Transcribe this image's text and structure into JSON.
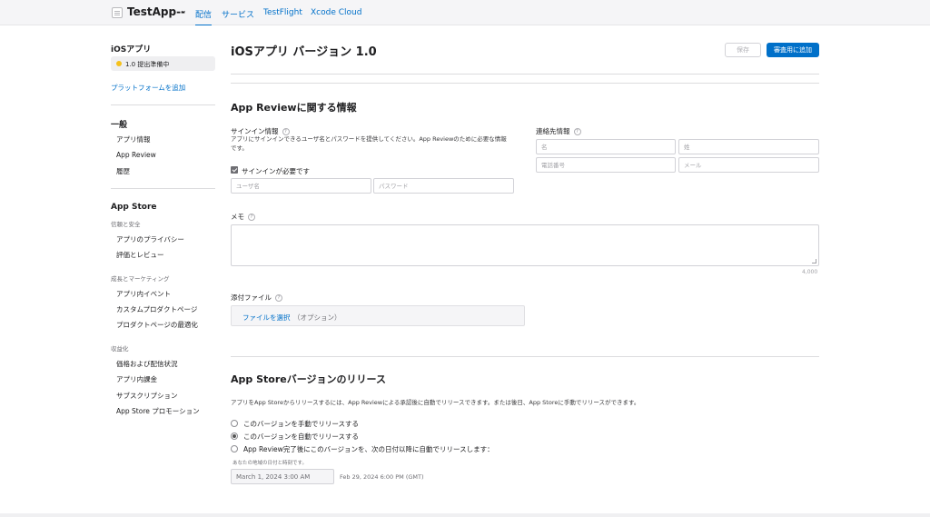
{
  "topbar": {
    "app_name": "TestApp--",
    "tabs": [
      "配信",
      "サービス",
      "TestFlight",
      "Xcode Cloud"
    ]
  },
  "sidebar": {
    "platform_title": "iOSアプリ",
    "status": "1.0 提出準備中",
    "add_platform": "プラットフォームを追加",
    "general_title": "一般",
    "general_items": [
      "アプリ情報",
      "App Review",
      "履歴"
    ],
    "appstore_title": "App Store",
    "group_trust": "信頼と安全",
    "trust_items": [
      "アプリのプライバシー",
      "評価とレビュー"
    ],
    "group_growth": "成長とマーケティング",
    "growth_items": [
      "アプリ内イベント",
      "カスタムプロダクトページ",
      "プロダクトページの最適化"
    ],
    "group_monetization": "収益化",
    "monetization_items": [
      "価格および配信状況",
      "アプリ内課金",
      "サブスクリプション",
      "App Store プロモーション"
    ]
  },
  "main": {
    "page_title": "iOSアプリ バージョン 1.0",
    "save_button": "保存",
    "add_review_button": "審査用に追加",
    "review_section_title": "App Reviewに関する情報",
    "signin_label": "サインイン情報",
    "signin_desc": "アプリにサインインできるユーザ名とパスワードを提供してください。App Reviewのために必要な情報です。",
    "signin_required": "サインインが必要です",
    "username_placeholder": "ユーザ名",
    "password_placeholder": "パスワード",
    "contact_label": "連絡先情報",
    "first_name_placeholder": "名",
    "last_name_placeholder": "姓",
    "phone_placeholder": "電話番号",
    "email_placeholder": "メール",
    "memo_label": "メモ",
    "memo_counter": "4,000",
    "attachment_label": "添付ファイル",
    "choose_file": "ファイルを選択",
    "optional": "（オプション）",
    "release_section_title": "App Storeバージョンのリリース",
    "release_desc": "アプリをApp Storeからリリースするには、App Reviewによる承認後に自動でリリースできます。または後日、App Storeに手動でリリースができます。",
    "release_options": [
      "このバージョンを手動でリリースする",
      "このバージョンを自動でリリースする",
      "App Review完了後にこのバージョンを、次の日付以降に自動でリリースします："
    ],
    "selected_release_option": 1,
    "local_date_note": "あなたの地域の日付と時刻です。",
    "date_value": "March 1, 2024 3:00 AM",
    "gmt_value": "Feb 29, 2024 6:00 PM (GMT)"
  },
  "colors": {
    "accent": "#0070c9",
    "status_dot": "#f5c11b"
  }
}
